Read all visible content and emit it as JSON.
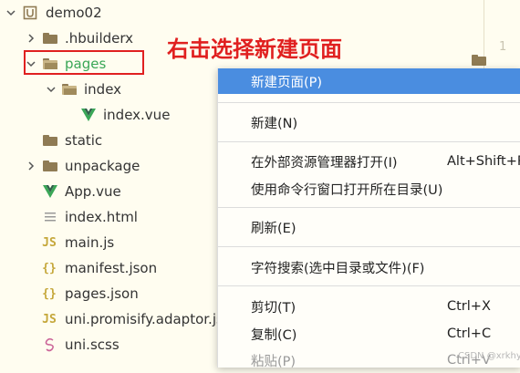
{
  "callout": {
    "text": "右击选择新建页面",
    "color": "#e02020"
  },
  "gutter": {
    "line_number": "1"
  },
  "tree": [
    {
      "label": "demo02",
      "icon": "project-icon",
      "expanded": true
    },
    {
      "label": ".hbuilderx",
      "icon": "folder-icon",
      "expanded": false
    },
    {
      "label": "pages",
      "icon": "folder-open-icon",
      "expanded": true,
      "highlighted": true
    },
    {
      "label": "index",
      "icon": "folder-open-icon",
      "expanded": true
    },
    {
      "label": "index.vue",
      "icon": "vue-icon"
    },
    {
      "label": "static",
      "icon": "folder-icon"
    },
    {
      "label": "unpackage",
      "icon": "folder-icon",
      "expanded": false
    },
    {
      "label": "App.vue",
      "icon": "vue-icon"
    },
    {
      "label": "index.html",
      "icon": "html-file-icon"
    },
    {
      "label": "main.js",
      "icon": "js-icon"
    },
    {
      "label": "manifest.json",
      "icon": "json-icon"
    },
    {
      "label": "pages.json",
      "icon": "json-icon"
    },
    {
      "label": "uni.promisify.adaptor.js",
      "icon": "js-icon"
    },
    {
      "label": "uni.scss",
      "icon": "scss-icon"
    }
  ],
  "context_menu": {
    "items": [
      {
        "label": "新建页面(P)",
        "shortcut": "",
        "active": true
      },
      {
        "label": "新建(N)",
        "shortcut": ""
      },
      {
        "label": "在外部资源管理器打开(I)",
        "shortcut": "Alt+Shift+R"
      },
      {
        "label": "使用命令行窗口打开所在目录(U)",
        "shortcut": ""
      },
      {
        "label": "刷新(E)",
        "shortcut": ""
      },
      {
        "label": "字符搜索(选中目录或文件)(F)",
        "shortcut": ""
      },
      {
        "label": "剪切(T)",
        "shortcut": "Ctrl+X"
      },
      {
        "label": "复制(C)",
        "shortcut": "Ctrl+C"
      },
      {
        "label": "粘贴(P)",
        "shortcut": "Ctrl+V",
        "disabled": true
      }
    ]
  },
  "watermark": "CSDN @xrkhy",
  "colors": {
    "background": "#fffdf0",
    "menu_active": "#4a8de0",
    "vue_green": "#3aa757",
    "folder": "#8f7b54",
    "js_yellow": "#c5a73a"
  }
}
